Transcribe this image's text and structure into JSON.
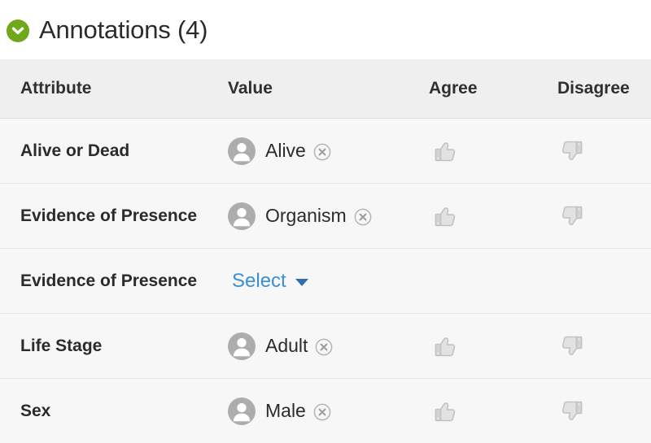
{
  "section": {
    "title": "Annotations (4)",
    "toggle_icon": "chevron-down-circle-icon",
    "toggle_color": "#6fa81b",
    "expanded": true
  },
  "table": {
    "columns": [
      {
        "key": "attribute",
        "label": "Attribute"
      },
      {
        "key": "value",
        "label": "Value"
      },
      {
        "key": "agree",
        "label": "Agree"
      },
      {
        "key": "disagree",
        "label": "Disagree"
      }
    ],
    "rows": [
      {
        "attribute": "Alive or Dead",
        "value": "Alive",
        "value_kind": "annotation",
        "avatar_icon": "user-avatar-icon",
        "remove_icon": "remove-circle-icon",
        "agree_icon": "thumbs-up-icon",
        "disagree_icon": "thumbs-down-icon"
      },
      {
        "attribute": "Evidence of Presence",
        "value": "Organism",
        "value_kind": "annotation",
        "avatar_icon": "user-avatar-icon",
        "remove_icon": "remove-circle-icon",
        "agree_icon": "thumbs-up-icon",
        "disagree_icon": "thumbs-down-icon"
      },
      {
        "attribute": "Evidence of Presence",
        "value": "Select",
        "value_kind": "select",
        "caret_icon": "caret-down-icon",
        "link_color": "#3a8fd4"
      },
      {
        "attribute": "Life Stage",
        "value": "Adult",
        "value_kind": "annotation",
        "avatar_icon": "user-avatar-icon",
        "remove_icon": "remove-circle-icon",
        "agree_icon": "thumbs-up-icon",
        "disagree_icon": "thumbs-down-icon"
      },
      {
        "attribute": "Sex",
        "value": "Male",
        "value_kind": "annotation",
        "avatar_icon": "user-avatar-icon",
        "remove_icon": "remove-circle-icon",
        "agree_icon": "thumbs-up-icon",
        "disagree_icon": "thumbs-down-icon"
      }
    ]
  }
}
